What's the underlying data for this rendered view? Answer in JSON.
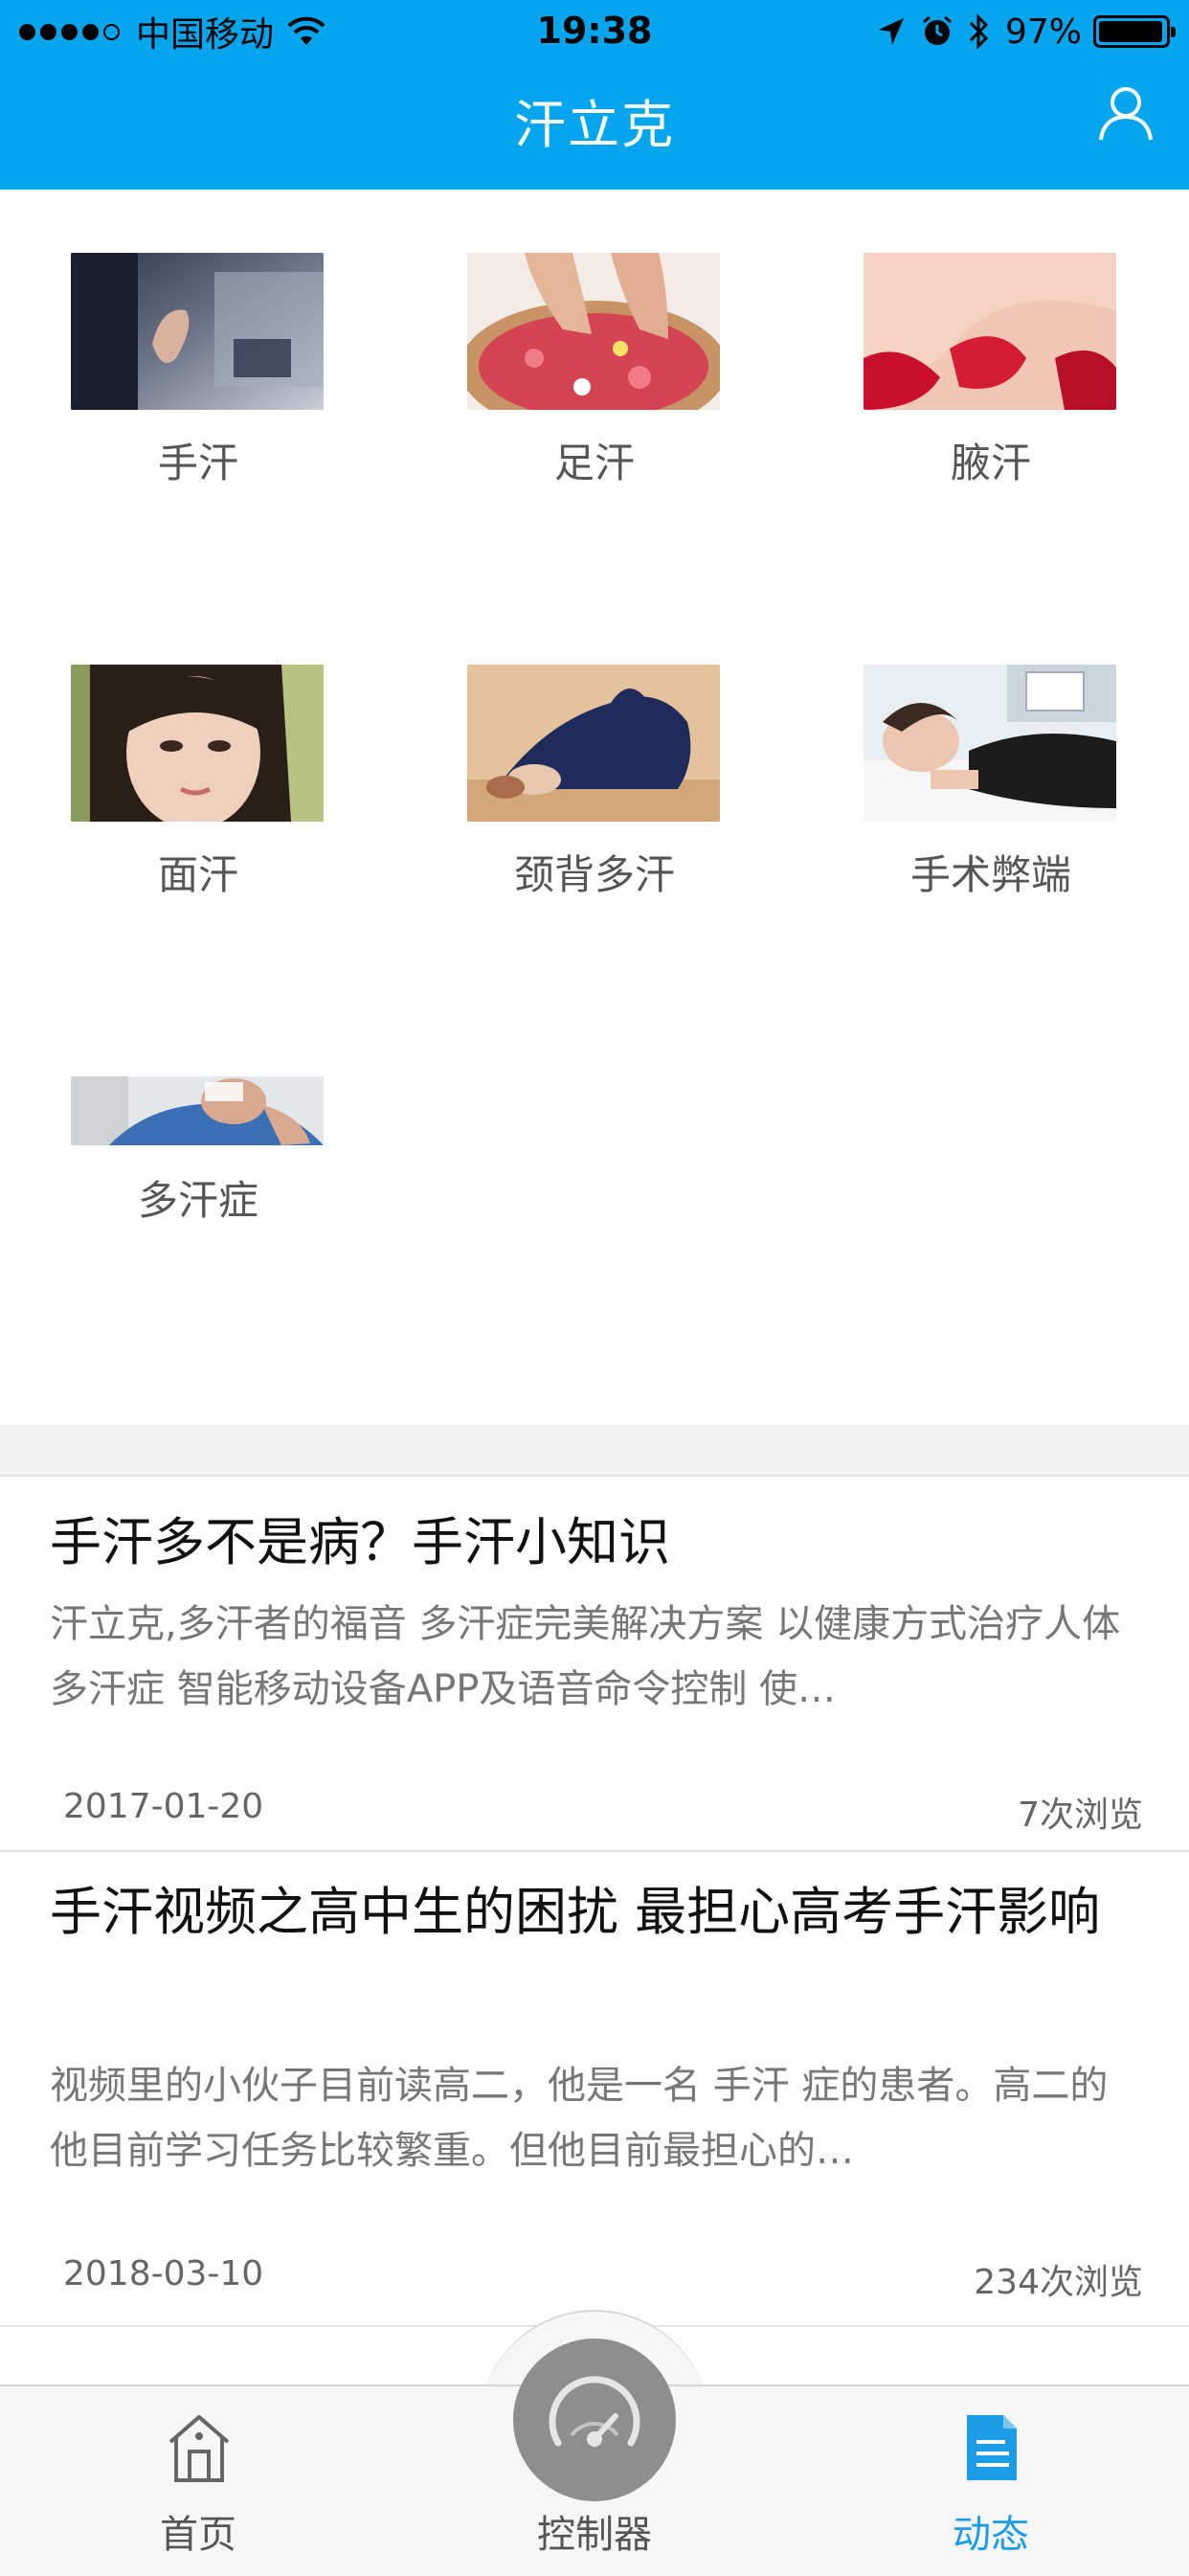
{
  "status_bar": {
    "carrier": "中国移动",
    "time": "19:38",
    "battery": "97%",
    "battery_level": 0.97
  },
  "header": {
    "title": "汗立克"
  },
  "categories": [
    {
      "label": "手汗"
    },
    {
      "label": "足汗"
    },
    {
      "label": "腋汗"
    },
    {
      "label": "面汗"
    },
    {
      "label": "颈背多汗"
    },
    {
      "label": "手术弊端"
    },
    {
      "label": "多汗症"
    }
  ],
  "articles": [
    {
      "title": "手汗多不是病？手汗小知识",
      "summary": "汗立克,多汗者的福音 多汗症完美解决方案 以健康方式治疗人体多汗症 智能移动设备APP及语音命令控制 使…",
      "date": "2017-01-20",
      "views": "7次浏览"
    },
    {
      "title": "手汗视频之高中生的困扰 最担心高考手汗影响",
      "summary": "视频里的小伙子目前读高二，他是一名 手汗 症的患者。高二的他目前学习任务比较繁重。但他目前最担心的…",
      "date": "2018-03-10",
      "views": "234次浏览"
    }
  ],
  "tabbar": {
    "home": "首页",
    "controller": "控制器",
    "news": "动态",
    "active": "动态",
    "active_color": "#1a9de6",
    "brand_color": "#03a5ec"
  }
}
